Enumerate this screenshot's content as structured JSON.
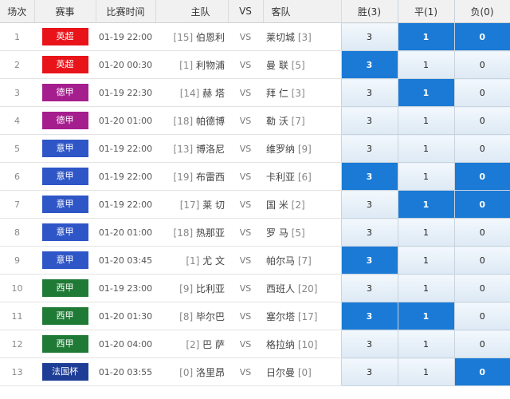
{
  "header": {
    "no": "场次",
    "league": "赛事",
    "time": "比赛时间",
    "home": "主队",
    "vs": "VS",
    "away": "客队",
    "win": "胜(3)",
    "draw": "平(1)",
    "lose": "负(0)"
  },
  "league_colors": {
    "英超": "#e8141a",
    "德甲": "#a51e8e",
    "意甲": "#2f56c7",
    "西甲": "#1f7a35",
    "法国杯": "#1e3e96"
  },
  "rows": [
    {
      "no": "1",
      "league": "英超",
      "time": "01-19 22:00",
      "home_rank": "[15]",
      "home": "伯恩利",
      "vs": "VS",
      "away": "莱切城",
      "away_rank": "[3]",
      "odds": [
        "3",
        "1",
        "0"
      ],
      "selected": [
        false,
        true,
        true
      ]
    },
    {
      "no": "2",
      "league": "英超",
      "time": "01-20 00:30",
      "home_rank": "[1]",
      "home": "利物浦",
      "vs": "VS",
      "away": "曼 联",
      "away_rank": "[5]",
      "odds": [
        "3",
        "1",
        "0"
      ],
      "selected": [
        true,
        false,
        false
      ]
    },
    {
      "no": "3",
      "league": "德甲",
      "time": "01-19 22:30",
      "home_rank": "[14]",
      "home": "赫 塔",
      "vs": "VS",
      "away": "拜 仁",
      "away_rank": "[3]",
      "odds": [
        "3",
        "1",
        "0"
      ],
      "selected": [
        false,
        true,
        false
      ]
    },
    {
      "no": "4",
      "league": "德甲",
      "time": "01-20 01:00",
      "home_rank": "[18]",
      "home": "帕德博",
      "vs": "VS",
      "away": "勒 沃",
      "away_rank": "[7]",
      "odds": [
        "3",
        "1",
        "0"
      ],
      "selected": [
        false,
        false,
        false
      ]
    },
    {
      "no": "5",
      "league": "意甲",
      "time": "01-19 22:00",
      "home_rank": "[13]",
      "home": "博洛尼",
      "vs": "VS",
      "away": "维罗纳",
      "away_rank": "[9]",
      "odds": [
        "3",
        "1",
        "0"
      ],
      "selected": [
        false,
        false,
        false
      ]
    },
    {
      "no": "6",
      "league": "意甲",
      "time": "01-19 22:00",
      "home_rank": "[19]",
      "home": "布雷西",
      "vs": "VS",
      "away": "卡利亚",
      "away_rank": "[6]",
      "odds": [
        "3",
        "1",
        "0"
      ],
      "selected": [
        true,
        false,
        true
      ]
    },
    {
      "no": "7",
      "league": "意甲",
      "time": "01-19 22:00",
      "home_rank": "[17]",
      "home": "莱 切",
      "vs": "VS",
      "away": "国 米",
      "away_rank": "[2]",
      "odds": [
        "3",
        "1",
        "0"
      ],
      "selected": [
        false,
        true,
        true
      ]
    },
    {
      "no": "8",
      "league": "意甲",
      "time": "01-20 01:00",
      "home_rank": "[18]",
      "home": "热那亚",
      "vs": "VS",
      "away": "罗 马",
      "away_rank": "[5]",
      "odds": [
        "3",
        "1",
        "0"
      ],
      "selected": [
        false,
        false,
        false
      ]
    },
    {
      "no": "9",
      "league": "意甲",
      "time": "01-20 03:45",
      "home_rank": "[1]",
      "home": "尤 文",
      "vs": "VS",
      "away": "帕尔马",
      "away_rank": "[7]",
      "odds": [
        "3",
        "1",
        "0"
      ],
      "selected": [
        true,
        false,
        false
      ]
    },
    {
      "no": "10",
      "league": "西甲",
      "time": "01-19 23:00",
      "home_rank": "[9]",
      "home": "比利亚",
      "vs": "VS",
      "away": "西班人",
      "away_rank": "[20]",
      "odds": [
        "3",
        "1",
        "0"
      ],
      "selected": [
        false,
        false,
        false
      ]
    },
    {
      "no": "11",
      "league": "西甲",
      "time": "01-20 01:30",
      "home_rank": "[8]",
      "home": "毕尔巴",
      "vs": "VS",
      "away": "塞尔塔",
      "away_rank": "[17]",
      "odds": [
        "3",
        "1",
        "0"
      ],
      "selected": [
        true,
        true,
        false
      ]
    },
    {
      "no": "12",
      "league": "西甲",
      "time": "01-20 04:00",
      "home_rank": "[2]",
      "home": "巴 萨",
      "vs": "VS",
      "away": "格拉纳",
      "away_rank": "[10]",
      "odds": [
        "3",
        "1",
        "0"
      ],
      "selected": [
        false,
        false,
        false
      ]
    },
    {
      "no": "13",
      "league": "法国杯",
      "time": "01-20 03:55",
      "home_rank": "[0]",
      "home": "洛里昂",
      "vs": "VS",
      "away": "日尔曼",
      "away_rank": "[0]",
      "odds": [
        "3",
        "1",
        "0"
      ],
      "selected": [
        false,
        false,
        true
      ]
    }
  ]
}
